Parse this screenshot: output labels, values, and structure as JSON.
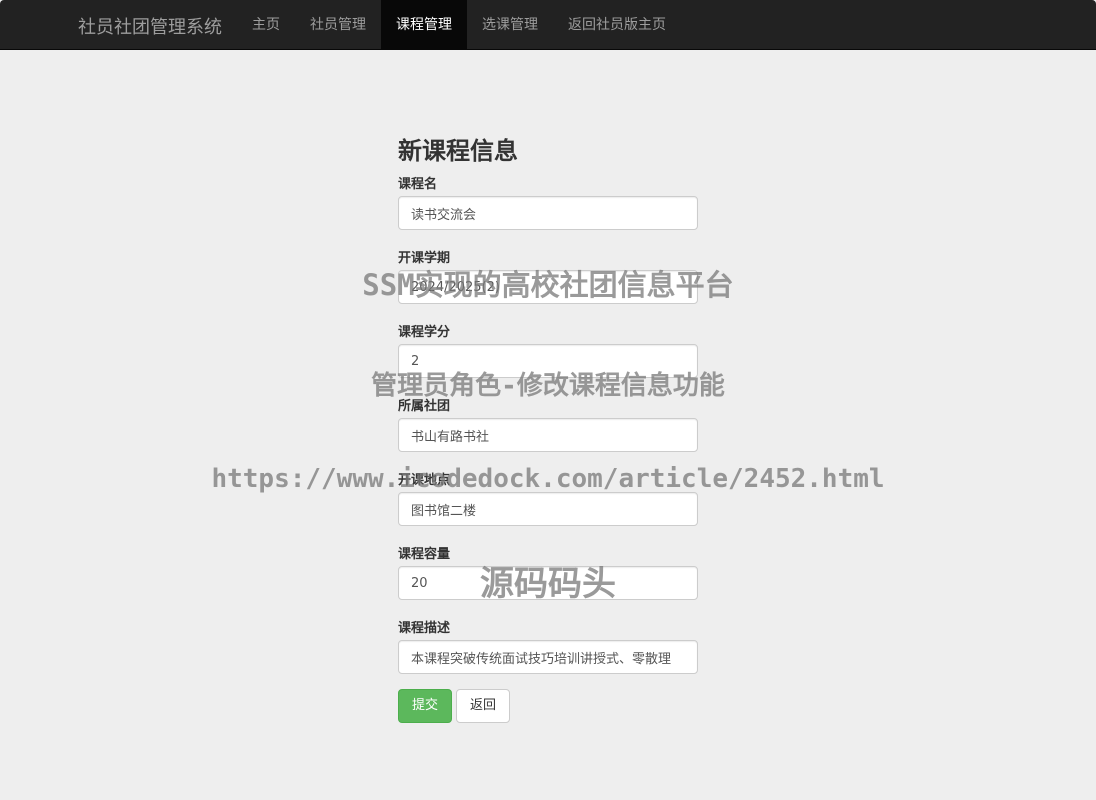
{
  "navbar": {
    "brand": "社员社团管理系统",
    "items": [
      {
        "label": "主页"
      },
      {
        "label": "社员管理"
      },
      {
        "label": "课程管理"
      },
      {
        "label": "选课管理"
      },
      {
        "label": "返回社员版主页"
      }
    ],
    "active_index": 2
  },
  "form": {
    "title": "新课程信息",
    "fields": [
      {
        "label": "课程名",
        "value": "读书交流会"
      },
      {
        "label": "开课学期",
        "value": "2024/2025(2)"
      },
      {
        "label": "课程学分",
        "value": "2"
      },
      {
        "label": "所属社团",
        "value": "书山有路书社"
      },
      {
        "label": "开课地点",
        "value": "图书馆二楼"
      },
      {
        "label": "课程容量",
        "value": "20"
      },
      {
        "label": "课程描述",
        "value": "本课程突破传统面试技巧培训讲授式、零散理"
      }
    ],
    "submit_label": "提交",
    "back_label": "返回"
  },
  "watermark": {
    "line1": "SSM实现的高校社团信息平台",
    "line2": "管理员角色-修改课程信息功能",
    "line3": "https://www.icodedock.com/article/2452.html",
    "line4": "源码码头"
  },
  "colors": {
    "navbar_bg": "#222222",
    "active_nav_bg": "#080808",
    "page_bg": "#eeeeee",
    "submit_button": "#5cb85c"
  }
}
